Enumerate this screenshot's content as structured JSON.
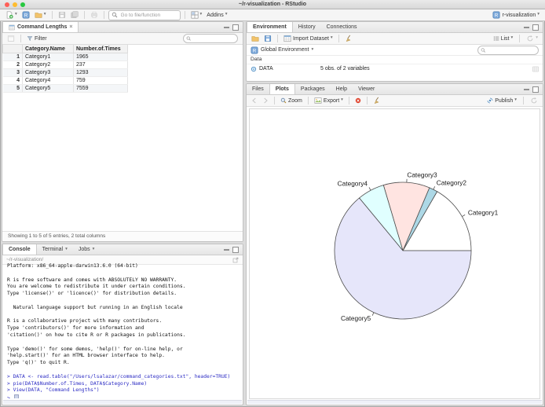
{
  "window": {
    "title": "~/r-visualization - RStudio",
    "traffic_lights": [
      "#ff5f57",
      "#febc2e",
      "#28c840"
    ]
  },
  "toolbar": {
    "goto_placeholder": "Go to file/function",
    "addins_label": "Addins",
    "project_label": "r-visualization"
  },
  "icons": {
    "r_letter": "R"
  },
  "viewer": {
    "tab_label": "Command Lengths",
    "filter_label": "Filter",
    "status": "Showing 1 to 5 of 5 entries, 2 total columns",
    "table": {
      "columns": [
        "",
        "Category.Name",
        "Number.of.Times"
      ],
      "rows": [
        [
          "1",
          "Category1",
          "1965"
        ],
        [
          "2",
          "Category2",
          "237"
        ],
        [
          "3",
          "Category3",
          "1293"
        ],
        [
          "4",
          "Category4",
          "759"
        ],
        [
          "5",
          "Category5",
          "7559"
        ]
      ]
    }
  },
  "console": {
    "tabs": [
      "Console",
      "Terminal",
      "Jobs"
    ],
    "breadcrumb": "~/r-visualization/",
    "input_color": "#2d2dc4",
    "lines": [
      {
        "text": "Platform: x86_64-apple-darwin13.6.0 (64-bit)",
        "type": "output"
      },
      {
        "text": "",
        "type": "output"
      },
      {
        "text": "R is free software and comes with ABSOLUTELY NO WARRANTY.",
        "type": "output"
      },
      {
        "text": "You are welcome to redistribute it under certain conditions.",
        "type": "output"
      },
      {
        "text": "Type 'license()' or 'licence()' for distribution details.",
        "type": "output"
      },
      {
        "text": "",
        "type": "output"
      },
      {
        "text": "  Natural language support but running in an English locale",
        "type": "output"
      },
      {
        "text": "",
        "type": "output"
      },
      {
        "text": "R is a collaborative project with many contributors.",
        "type": "output"
      },
      {
        "text": "Type 'contributors()' for more information and",
        "type": "output"
      },
      {
        "text": "'citation()' on how to cite R or R packages in publications.",
        "type": "output"
      },
      {
        "text": "",
        "type": "output"
      },
      {
        "text": "Type 'demo()' for some demos, 'help()' for on-line help, or",
        "type": "output"
      },
      {
        "text": "'help.start()' for an HTML browser interface to help.",
        "type": "output"
      },
      {
        "text": "Type 'q()' to quit R.",
        "type": "output"
      },
      {
        "text": "",
        "type": "output"
      },
      {
        "text": "> DATA <- read.table(\"/Users/lsalazar/command_categories.txt\", header=TRUE)",
        "type": "input"
      },
      {
        "text": "> pie(DATA$Number.of.Times, DATA$Category.Name)",
        "type": "input"
      },
      {
        "text": "> View(DATA, \"Command Lengths\")",
        "type": "input"
      },
      {
        "text": "> ",
        "type": "input",
        "cursor": true
      }
    ]
  },
  "environment": {
    "tabs": [
      "Environment",
      "History",
      "Connections"
    ],
    "import_label": "Import Dataset",
    "list_label": "List",
    "scope_label": "Global Environment",
    "section_label": "Data",
    "object_name": "DATA",
    "object_desc": "5 obs. of 2 variables"
  },
  "plots": {
    "tabs": [
      "Files",
      "Plots",
      "Packages",
      "Help",
      "Viewer"
    ],
    "zoom_label": "Zoom",
    "export_label": "Export",
    "publish_label": "Publish"
  },
  "chart_data": {
    "type": "pie",
    "categories": [
      "Category1",
      "Category2",
      "Category3",
      "Category4",
      "Category5"
    ],
    "values": [
      1965,
      237,
      1293,
      759,
      7559
    ],
    "colors": [
      "#ffffff",
      "#add8e6",
      "#ffe4e1",
      "#e0ffff",
      "#e6e6fa"
    ],
    "stroke": "#4d4d4d",
    "label_color": "#1a1a1a",
    "start_angle_deg": 0,
    "direction": "counterclockwise",
    "title": ""
  }
}
